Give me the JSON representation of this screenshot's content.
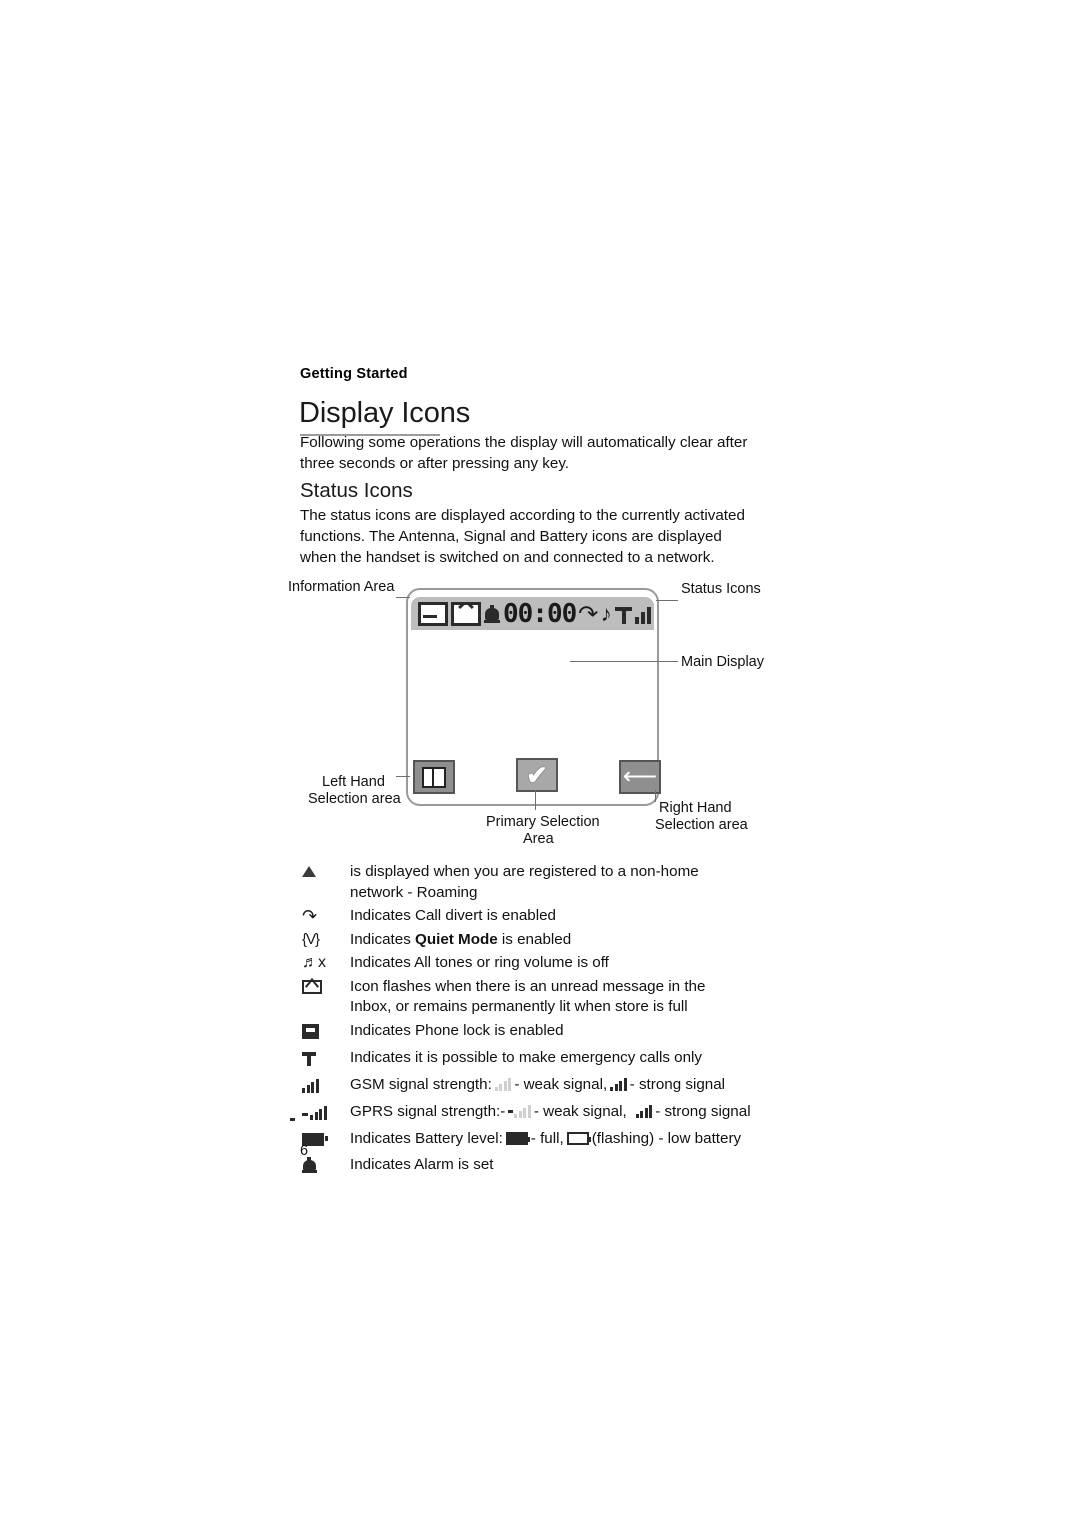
{
  "document": {
    "running_head": "Getting Started",
    "title": "Display Icons",
    "intro": "Following some operations the display will automatically clear after three seconds or after pressing any key.",
    "subtitle": "Status Icons",
    "subtitle_para": "The status icons are displayed according to the currently activated functions. The Antenna, Signal and Battery icons are displayed when the handset is switched on and connected to a network.",
    "page_number": "6"
  },
  "diagram": {
    "status_bar": {
      "icons": [
        "envelope-outline-icon",
        "envelope-icon",
        "alarm-icon"
      ],
      "clock": "00:00",
      "divert_icon": "call-divert-icon",
      "note_icon": "music-note-icon",
      "antenna_icon": "antenna-icon",
      "signal_icon": "signal-bars-icon"
    },
    "callouts": {
      "information_area": "Information Area",
      "status_icons": "Status Icons",
      "main_display": "Main Display",
      "left_hand": "Left Hand",
      "left_hand_2": "Selection area",
      "primary_selection": "Primary Selection",
      "primary_selection_2": "Area",
      "right_hand": "Right Hand",
      "right_hand_2": "Selection area"
    },
    "softkeys": {
      "left": "phonebook-icon",
      "middle": "checkmark-icon",
      "right": "back-arrow-icon"
    }
  },
  "legend": {
    "rows": [
      {
        "icon": "roaming-triangle-icon",
        "text": "is displayed when you are registered to a non-home network - Roaming"
      },
      {
        "icon": "call-divert-icon",
        "text": "Indicates Call divert is enabled"
      },
      {
        "icon": "quiet-mode-icon",
        "text_pre": "Indicates ",
        "text_bold": "Quiet Mode",
        "text_post": " is enabled"
      },
      {
        "icon": "mute-icon",
        "text": "Indicates All tones or ring volume is off"
      },
      {
        "icon": "envelope-icon",
        "text": "Icon flashes when there is an unread message in the Inbox, or remains permanently lit when store is full"
      },
      {
        "icon": "phone-lock-icon",
        "text": "Indicates Phone lock is enabled"
      },
      {
        "icon": "emergency-only-icon",
        "text": "Indicates it is possible to make emergency calls only"
      },
      {
        "icon": "gsm-signal-icon",
        "text_pre": "GSM signal strength:",
        "weak_label": "- weak signal,",
        "strong_label": "- strong signal"
      },
      {
        "icon": "gprs-signal-icon",
        "text_pre": "GPRS signal strength:-",
        "weak_label": "- weak signal,",
        "strong_label": "- strong signal"
      },
      {
        "icon": "battery-icon",
        "text_pre": "Indicates Battery level:",
        "full_label": "- full,",
        "low_label": "(flashing) - low battery"
      },
      {
        "icon": "alarm-icon",
        "text": "Indicates Alarm is set"
      }
    ]
  }
}
